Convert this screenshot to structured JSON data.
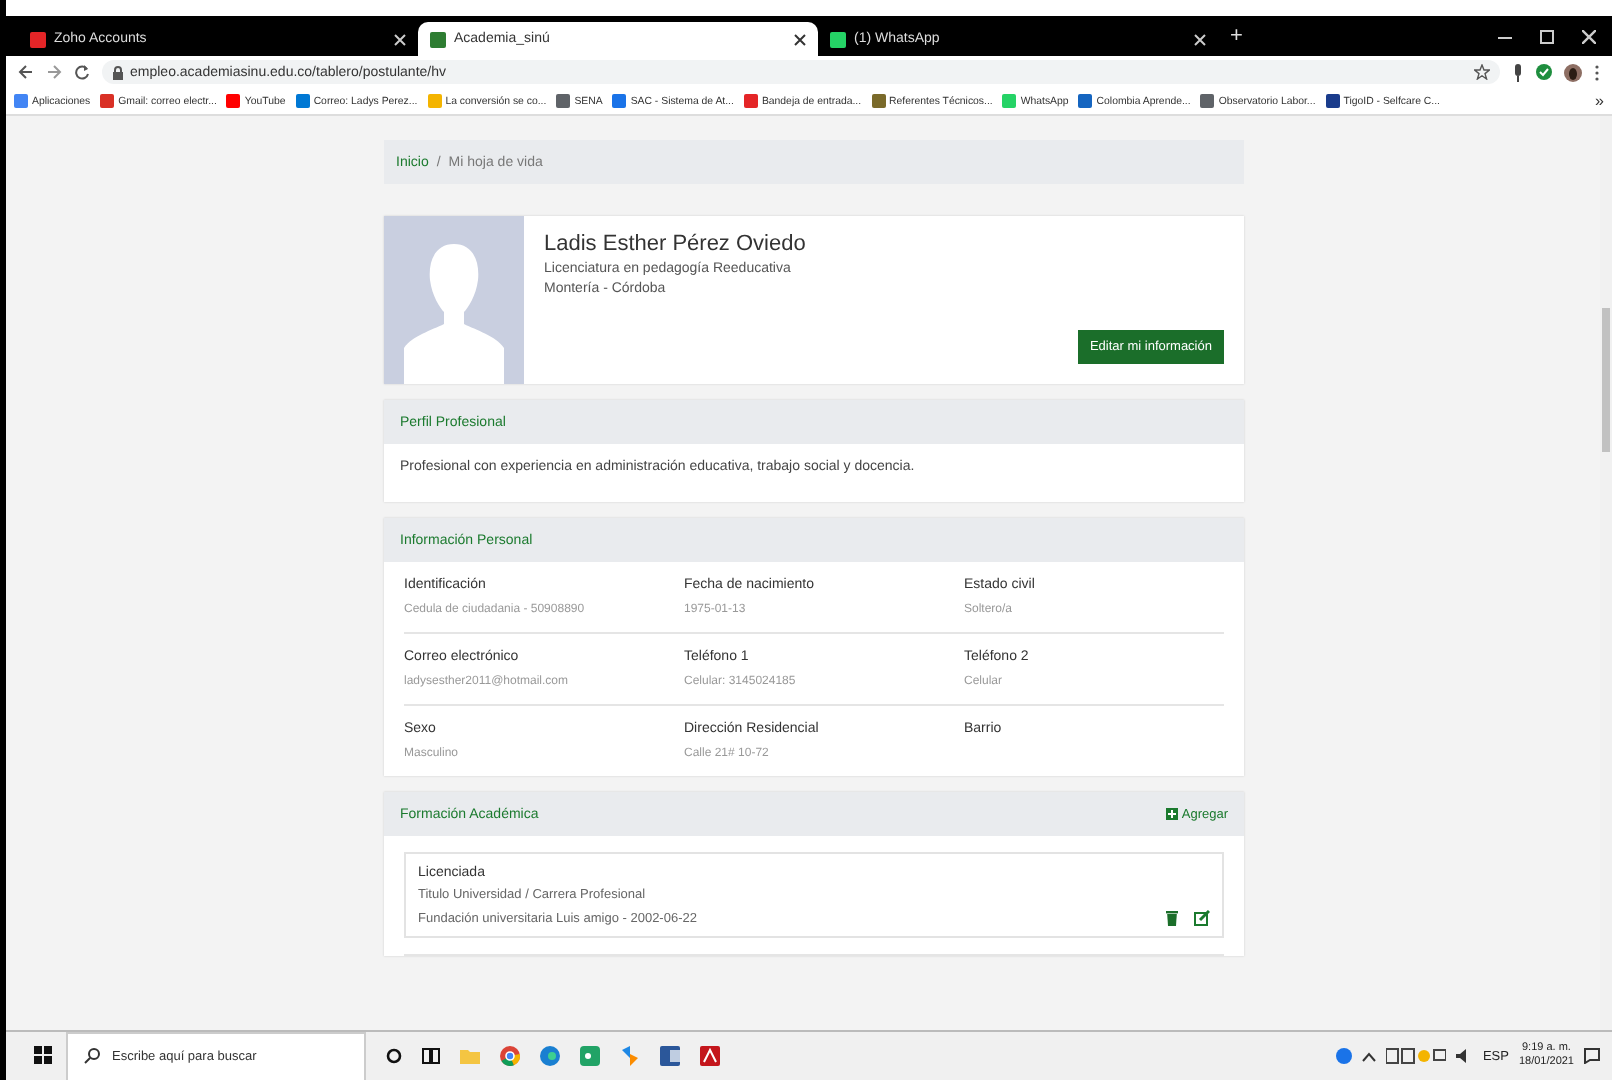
{
  "browser": {
    "tabs": [
      {
        "title": "Zoho Accounts",
        "selected": false,
        "color": "#e42527"
      },
      {
        "title": "Academia_sinú",
        "selected": true,
        "color": "#2e7d32"
      },
      {
        "title": "(1) WhatsApp",
        "selected": false,
        "color": "#25d366"
      }
    ],
    "new_tab": "+",
    "url": "empleo.academiasinu.edu.co/tablero/postulante/hv",
    "bookmarks": [
      {
        "label": "Aplicaciones",
        "color": "#4285f4"
      },
      {
        "label": "Gmail: correo electr...",
        "color": "#d93025"
      },
      {
        "label": "YouTube",
        "color": "#ff0000"
      },
      {
        "label": "Correo: Ladys Perez...",
        "color": "#0078d4"
      },
      {
        "label": "La conversión se co...",
        "color": "#f4b400"
      },
      {
        "label": "SENA",
        "color": "#5f6368"
      },
      {
        "label": "SAC - Sistema de At...",
        "color": "#1a73e8"
      },
      {
        "label": "Bandeja de entrada...",
        "color": "#e42527"
      },
      {
        "label": "Referentes Técnicos...",
        "color": "#7a6a2a"
      },
      {
        "label": "WhatsApp",
        "color": "#25d366"
      },
      {
        "label": "Colombia Aprende...",
        "color": "#1565c0"
      },
      {
        "label": "Observatorio Labor...",
        "color": "#5f6368"
      },
      {
        "label": "TigoID - Selfcare C...",
        "color": "#1a3c8c"
      }
    ],
    "more_bookmarks": "»"
  },
  "breadcrumb": [
    {
      "label": "Inicio",
      "kind": "link"
    },
    {
      "label": "Mi hoja de vida",
      "kind": "current"
    }
  ],
  "breadcrumb_separator": "/",
  "profile": {
    "name": "Ladis Esther Pérez Oviedo",
    "degree": "Licenciatura en pedagogía Reeducativa",
    "location": "Montería - Córdoba",
    "edit_button": "Editar mi información"
  },
  "professional_profile": {
    "title": "Perfil Profesional",
    "text": "Profesional con experiencia en administración educativa, trabajo social y docencia."
  },
  "personal_info": {
    "title": "Información Personal",
    "fields": [
      {
        "label": "Identificación",
        "value": "Cedula de ciudadania - 50908890"
      },
      {
        "label": "Fecha de nacimiento",
        "value": "1975-01-13"
      },
      {
        "label": "Estado civil",
        "value": "Soltero/a"
      },
      {
        "label": "Correo electrónico",
        "value": "ladysesther2011@hotmail.com"
      },
      {
        "label": "Teléfono 1",
        "value": "Celular: 3145024185"
      },
      {
        "label": "Teléfono 2",
        "value": "Celular"
      },
      {
        "label": "Sexo",
        "value": "Masculino"
      },
      {
        "label": "Dirección Residencial",
        "value": "Calle 21# 10-72"
      },
      {
        "label": "Barrio"
      }
    ]
  },
  "academic": {
    "title": "Formación Académica",
    "add_button": "Agregar",
    "entries": [
      {
        "title": "Licenciada",
        "type": "Titulo Universidad / Carrera Profesional",
        "detail": "Fundación universitaria Luis amigo - 2002-06-22"
      }
    ]
  },
  "taskbar": {
    "search_placeholder": "Escribe aquí para buscar",
    "language": "ESP",
    "time": "9:19 a. m.",
    "date": "18/01/2021"
  }
}
